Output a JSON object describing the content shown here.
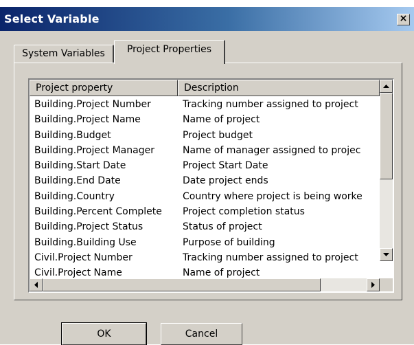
{
  "window": {
    "title": "Select Variable",
    "close_label": "×"
  },
  "tabs": [
    {
      "label": "System Variables",
      "active": false
    },
    {
      "label": "Project Properties",
      "active": true
    }
  ],
  "list": {
    "columns": [
      "Project property",
      "Description"
    ],
    "rows": [
      {
        "property": "Building.Project Number",
        "description": "Tracking number assigned to project"
      },
      {
        "property": "Building.Project Name",
        "description": "Name of project"
      },
      {
        "property": "Building.Budget",
        "description": "Project budget"
      },
      {
        "property": "Building.Project Manager",
        "description": "Name of manager assigned to projec"
      },
      {
        "property": "Building.Start Date",
        "description": "Project Start Date"
      },
      {
        "property": "Building.End Date",
        "description": "Date project ends"
      },
      {
        "property": "Building.Country",
        "description": "Country where project is being worke"
      },
      {
        "property": "Building.Percent Complete",
        "description": "Project completion status"
      },
      {
        "property": "Building.Project Status",
        "description": "Status of project"
      },
      {
        "property": "Building.Building Use",
        "description": "Purpose of building"
      },
      {
        "property": "Civil.Project Number",
        "description": "Tracking number assigned to project"
      },
      {
        "property": "Civil.Project Name",
        "description": "Name of project"
      }
    ]
  },
  "buttons": {
    "ok": "OK",
    "cancel": "Cancel"
  },
  "icons": {
    "close": "close-icon",
    "scroll_up": "arrow-up-icon",
    "scroll_down": "arrow-down-icon",
    "scroll_left": "arrow-left-icon",
    "scroll_right": "arrow-right-icon"
  },
  "colors": {
    "titlebar_start": "#0a246a",
    "titlebar_end": "#a6caf0",
    "face": "#d4d0c8"
  }
}
